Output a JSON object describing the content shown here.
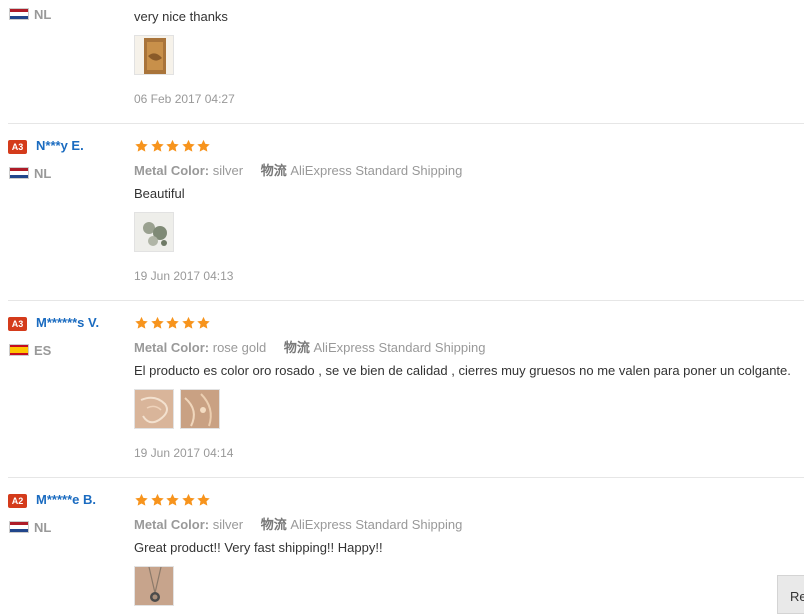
{
  "reviews": [
    {
      "country": "NL",
      "flag": "nl",
      "text": "very nice thanks",
      "date": "06 Feb 2017 04:27",
      "photos": 1
    },
    {
      "level": "A3",
      "user": "N***y E.",
      "country": "NL",
      "flag": "nl",
      "stars": 5,
      "color_label": "Metal Color:",
      "color_value": "silver",
      "ship_label": "物流",
      "ship_value": "AliExpress Standard Shipping",
      "text": "Beautiful",
      "date": "19 Jun 2017 04:13",
      "photos": 1
    },
    {
      "level": "A3",
      "user": "M******s V.",
      "country": "ES",
      "flag": "es",
      "stars": 5,
      "color_label": "Metal Color:",
      "color_value": "rose gold",
      "ship_label": "物流",
      "ship_value": "AliExpress Standard Shipping",
      "text": "El producto es color oro rosado , se ve bien de calidad , cierres muy gruesos no me valen para poner un colgante.",
      "date": "19 Jun 2017 04:14",
      "photos": 2
    },
    {
      "level": "A2",
      "user": "M*****e B.",
      "country": "NL",
      "flag": "nl",
      "stars": 5,
      "color_label": "Metal Color:",
      "color_value": "silver",
      "ship_label": "物流",
      "ship_value": "AliExpress Standard Shipping",
      "text": "Great product!! Very fast shipping!! Happy!!",
      "date": "",
      "photos": 1
    }
  ],
  "float_button_label": "Re",
  "colors": {
    "star": "#f7941d",
    "username": "#1a6bc0",
    "badge": "#d43b1b"
  }
}
